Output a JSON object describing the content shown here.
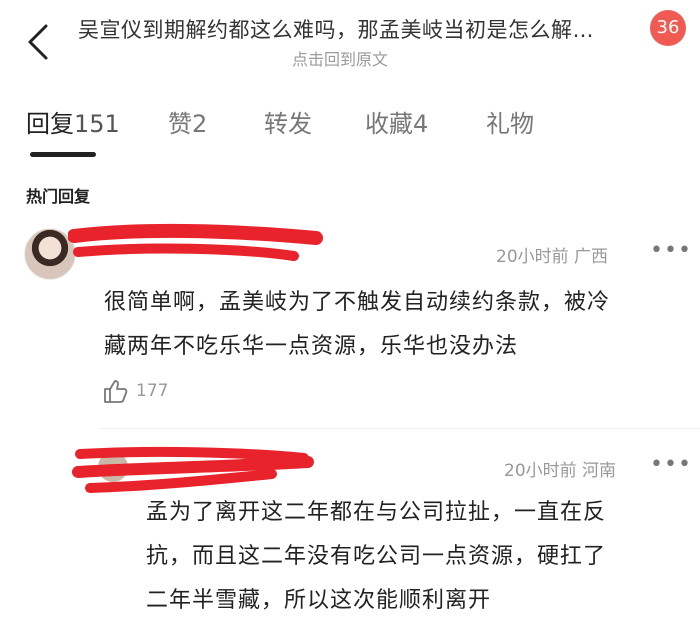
{
  "header": {
    "title": "吴宣仪到期解约都这么难吗，那孟美岐当初是怎么解…",
    "subtitle": "点击回到原文",
    "notification_count": "36"
  },
  "tabs": [
    {
      "label": "回复",
      "count": "151",
      "active": true
    },
    {
      "label": "赞",
      "count": "2",
      "active": false
    },
    {
      "label": "转发",
      "count": "",
      "active": false
    },
    {
      "label": "收藏",
      "count": "4",
      "active": false
    },
    {
      "label": "礼物",
      "count": "",
      "active": false
    }
  ],
  "section_title": "热门回复",
  "comments": [
    {
      "time": "20小时前",
      "location": "广西",
      "text_line1": "很简单啊，孟美岐为了不触发自动续约条款，被冷",
      "text_line2": "藏两年不吃乐华一点资源，乐华也没办法",
      "likes": "177"
    },
    {
      "time": "20小时前",
      "location": "河南",
      "text_line1": "孟为了离开这二年都在与公司拉扯，一直在反",
      "text_line2": "抗，而且这二年没有吃公司一点资源，硬扛了",
      "text_line3": "二年半雪藏，所以这次能顺利离开"
    }
  ],
  "colors": {
    "badge": "#ef5a52",
    "redaction": "#e8232b"
  }
}
